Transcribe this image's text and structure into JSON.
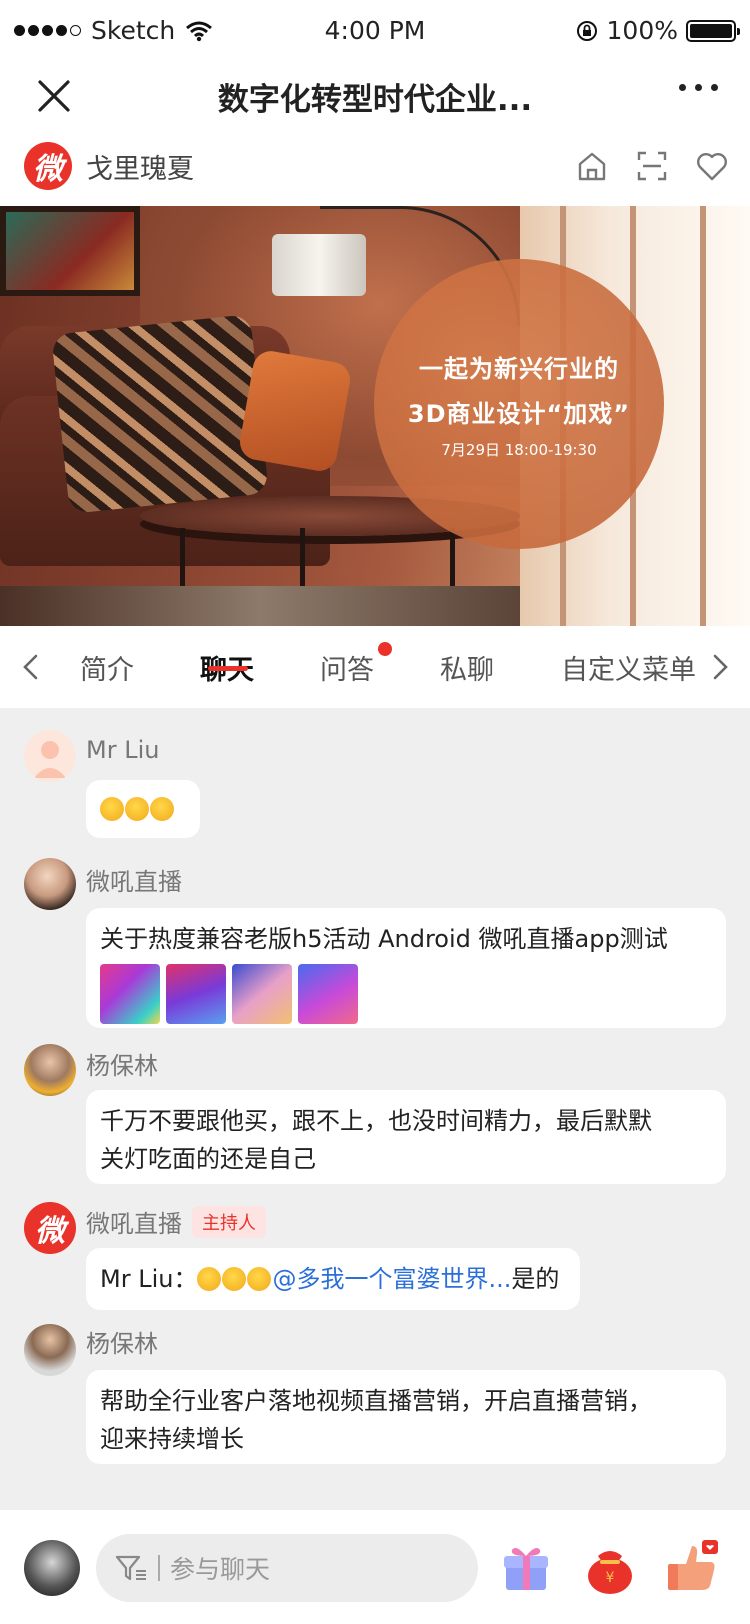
{
  "status": {
    "carrier": "Sketch",
    "time": "4:00 PM",
    "battery": "100%"
  },
  "titlebar": {
    "title": "数字化转型时代企业..."
  },
  "channel": {
    "logo_char": "微",
    "name": "戈里瑰夏"
  },
  "banner": {
    "line1": "一起为新兴行业的",
    "line2": "3D商业设计“加戏”",
    "line3": "7月29日 18:00-19:30"
  },
  "tabs": [
    {
      "label": "简介"
    },
    {
      "label": "聊天"
    },
    {
      "label": "问答"
    },
    {
      "label": "私聊"
    },
    {
      "label": "自定义菜单"
    }
  ],
  "messages": [
    {
      "name": "Mr Liu",
      "text": ""
    },
    {
      "name": "微吼直播",
      "text": "关于热度兼容老版h5活动 Android 微吼直播app测试"
    },
    {
      "name": "杨保林",
      "line1": "千万不要跟他买，跟不上，也没时间精力，最后默默",
      "line2": "关灯吃面的还是自己"
    },
    {
      "name": "微吼直播",
      "tag": "主持人",
      "prefix": "Mr Liu：",
      "mention": "@多我一个富婆世界...",
      "suffix": "是的",
      "logo_char": "微"
    },
    {
      "name": "杨保林",
      "line1": "帮助全行业客户落地视频直播营销，开启直播营销，",
      "line2": "迎来持续增长"
    }
  ],
  "input": {
    "placeholder": "参与聊天"
  },
  "colors": {
    "accent": "#e8322a",
    "mention": "#2b6fd8",
    "background": "#efefef"
  }
}
